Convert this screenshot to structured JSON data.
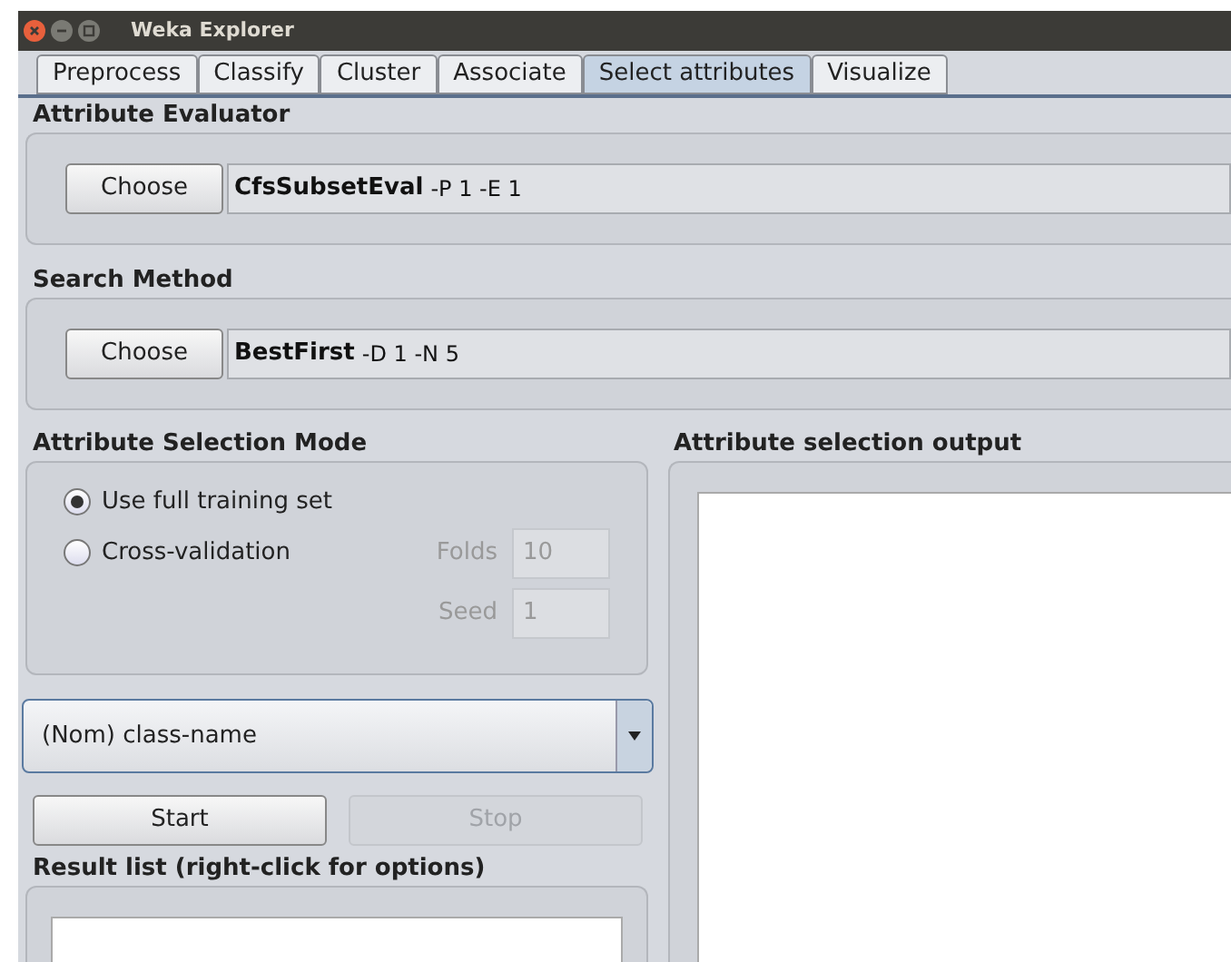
{
  "window": {
    "title": "Weka Explorer"
  },
  "tabs": [
    {
      "label": "Preprocess",
      "selected": false
    },
    {
      "label": "Classify",
      "selected": false
    },
    {
      "label": "Cluster",
      "selected": false
    },
    {
      "label": "Associate",
      "selected": false
    },
    {
      "label": "Select attributes",
      "selected": true
    },
    {
      "label": "Visualize",
      "selected": false
    }
  ],
  "attribute_evaluator": {
    "heading": "Attribute Evaluator",
    "button": "Choose",
    "name": "CfsSubsetEval",
    "options": "-P 1 -E 1"
  },
  "search_method": {
    "heading": "Search Method",
    "button": "Choose",
    "name": "BestFirst",
    "options": "-D 1 -N 5"
  },
  "selection_mode": {
    "heading": "Attribute Selection Mode",
    "options": [
      {
        "label": "Use full training set",
        "selected": true
      },
      {
        "label": "Cross-validation",
        "selected": false
      }
    ],
    "fields": [
      {
        "label": "Folds",
        "value": "10",
        "disabled": true
      },
      {
        "label": "Seed",
        "value": "1",
        "disabled": true
      }
    ]
  },
  "class_dropdown": {
    "value": "(Nom) class-name"
  },
  "buttons": [
    {
      "label": "Start",
      "disabled": false
    },
    {
      "label": "Stop",
      "disabled": true
    }
  ],
  "result_list": {
    "heading": "Result list (right-click for options)"
  },
  "output": {
    "heading": "Attribute selection output"
  }
}
